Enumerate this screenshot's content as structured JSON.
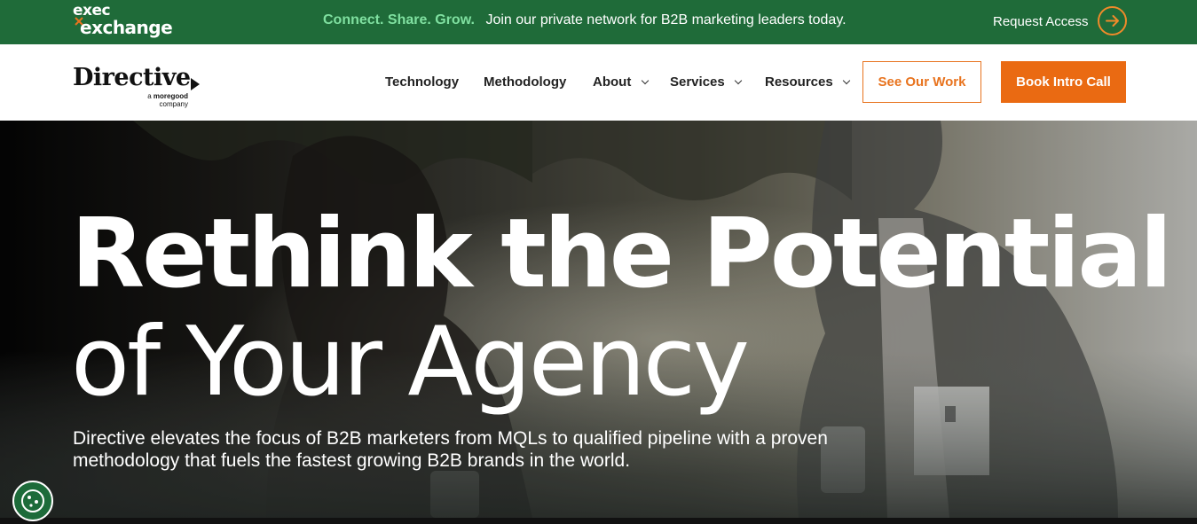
{
  "promo": {
    "logo_line1": "exec",
    "logo_line2": "exchange",
    "accent": "Connect. Share. Grow.",
    "message": "Join our private network for B2B marketing leaders today.",
    "request_access": "Request Access"
  },
  "nav": {
    "brand": "Directive",
    "brand_sub_prefix": "a",
    "brand_sub_name": "moregood",
    "brand_sub_suffix": "company",
    "items": [
      {
        "label": "Technology"
      },
      {
        "label": "Methodology"
      },
      {
        "label": "About"
      },
      {
        "label": "Services"
      },
      {
        "label": "Resources"
      }
    ],
    "see_work": "See Our Work",
    "book_call": "Book Intro Call"
  },
  "hero": {
    "title_line1": "Rethink the Potential",
    "title_line2": "of Your Agency",
    "lead": "Directive elevates the focus of B2B marketers from MQLs to qualified pipeline with a proven methodology that fuels the fastest growing B2B brands in the world."
  },
  "colors": {
    "promo_bg": "#1f6b39",
    "accent_green": "#7fe0a0",
    "orange": "#ea6a12"
  },
  "icons": {
    "request_arrow": "arrow-right-circle-icon",
    "cookie": "cookie-icon",
    "chevron": "chevron-down-icon"
  }
}
